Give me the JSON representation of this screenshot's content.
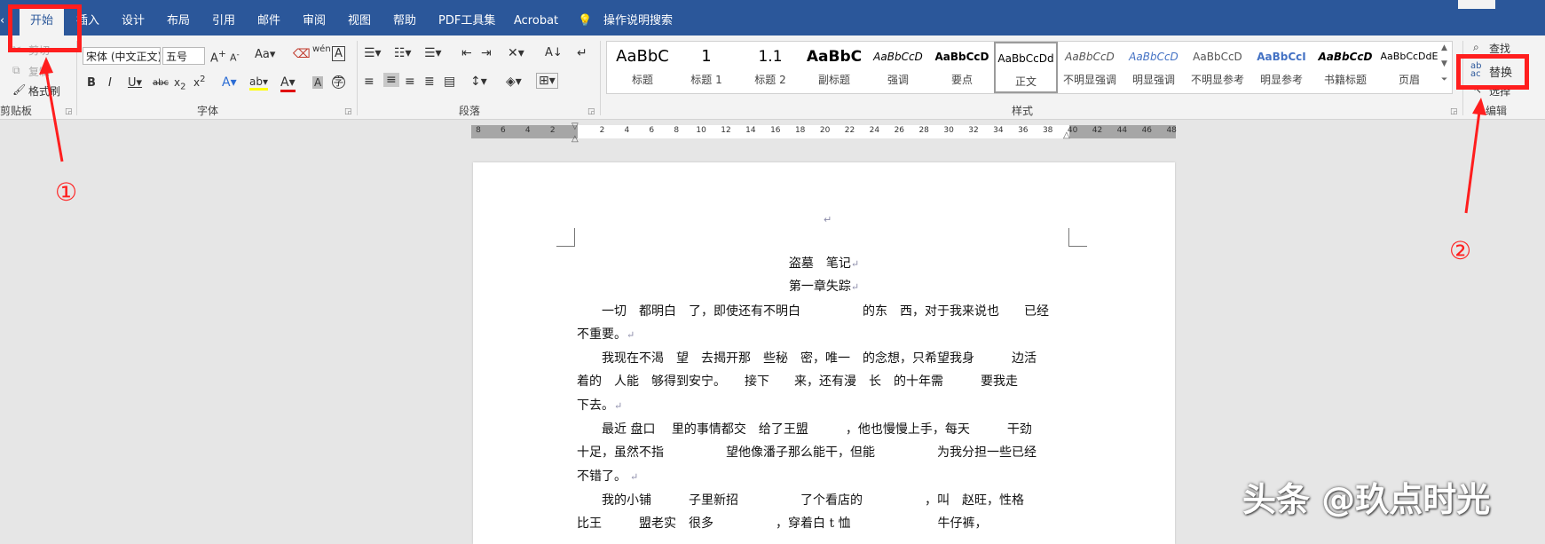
{
  "tabs": [
    "开始",
    "插入",
    "设计",
    "布局",
    "引用",
    "邮件",
    "审阅",
    "视图",
    "帮助",
    "PDF工具集",
    "Acrobat"
  ],
  "tell_me": "操作说明搜索",
  "clipboard": {
    "cut": "剪切",
    "copy": "复制",
    "format_painter": "格式刷",
    "group_label": "剪贴板"
  },
  "font": {
    "name": "宋体 (中文正文)",
    "size": "五号",
    "group_label": "字体"
  },
  "paragraph": {
    "group_label": "段落"
  },
  "styles": {
    "group_label": "样式",
    "items": [
      {
        "preview": "AaBbC",
        "name": "标题"
      },
      {
        "preview": "1",
        "name": "标题 1"
      },
      {
        "preview": "1.1",
        "name": "标题 2"
      },
      {
        "preview": "AaBbC",
        "name": "副标题"
      },
      {
        "preview": "AaBbCcD",
        "name": "强调"
      },
      {
        "preview": "AaBbCcD",
        "name": "要点"
      },
      {
        "preview": "AaBbCcDd",
        "name": "正文"
      },
      {
        "preview": "AaBbCcD",
        "name": "不明显强调"
      },
      {
        "preview": "AaBbCcD",
        "name": "明显强调"
      },
      {
        "preview": "AaBbCcD",
        "name": "不明显参考"
      },
      {
        "preview": "AaBbCcI",
        "name": "明显参考"
      },
      {
        "preview": "AaBbCcD",
        "name": "书籍标题"
      },
      {
        "preview": "AaBbCcDdE",
        "name": "页眉"
      }
    ]
  },
  "editing": {
    "find": "查找",
    "replace": "替换",
    "select": "选择",
    "group_label": "编辑"
  },
  "ruler_ticks": [
    "8",
    "6",
    "4",
    "2",
    "",
    "2",
    "4",
    "6",
    "8",
    "10",
    "12",
    "14",
    "16",
    "18",
    "20",
    "22",
    "24",
    "26",
    "28",
    "30",
    "32",
    "34",
    "36",
    "38",
    "40",
    "42",
    "44",
    "46",
    "48"
  ],
  "document": {
    "title": "盗墓　笔记",
    "chapter": "第一章失踪",
    "lines": [
      "　　一切　都明白　了，即使还有不明白　　　　　的东　西，对于我来说也　　已经",
      "不重要。",
      "　　我现在不渴　望　去揭开那　些秘　密，唯一　的念想，只希望我身　　　边活",
      "着的　人能　够得到安宁。　　接下　　来，还有漫　长　的十年需　　　要我走",
      "下去。",
      "　　最近 盘口　 里的事情都交　给了王盟　　　，他也慢慢上手，每天　　　干劲",
      "十足，虽然不指　　　　　望他像潘子那么能干，但能　　　　　为我分担一些已经",
      "不错了。",
      "　　我的小铺　　　子里新招　　　　　了个看店的　　　　　，叫　赵旺，性格",
      "比王　　　盟老实　很多　　　　　，穿着白 t 恤　　　　　　　牛仔裤，"
    ]
  },
  "annotations": [
    "①",
    "②"
  ],
  "watermark": "头条 @玖点时光",
  "colors": {
    "tabbar": "#2b579a",
    "annotation": "#ff1e1e"
  }
}
